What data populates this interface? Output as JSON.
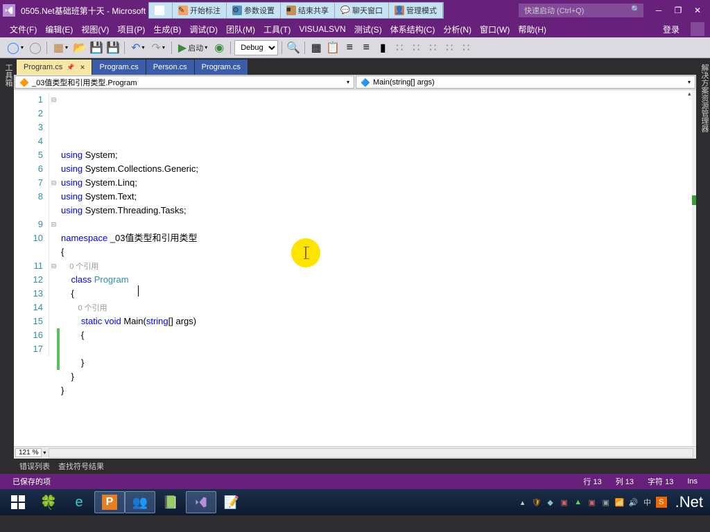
{
  "window": {
    "title": "0505.Net基础班第十天 - Microsoft",
    "quick_launch_placeholder": "快速启动 (Ctrl+Q)"
  },
  "share_toolbar": {
    "items": [
      {
        "label": "开始标注",
        "color": "#f4a460"
      },
      {
        "label": "参数设置",
        "color": "#5090c0"
      },
      {
        "label": "结束共享",
        "color": "#c09050"
      },
      {
        "label": "聊天窗口",
        "color": "#e0e0e0"
      },
      {
        "label": "管理模式",
        "color": "#d08050"
      }
    ]
  },
  "menu": {
    "items": [
      "文件(F)",
      "编辑(E)",
      "视图(V)",
      "项目(P)",
      "生成(B)",
      "调试(D)",
      "团队(M)",
      "工具(T)",
      "VISUALSVN",
      "测试(S)",
      "体系结构(C)",
      "分析(N)",
      "窗口(W)",
      "帮助(H)"
    ],
    "login": "登录"
  },
  "toolbar": {
    "start": "启动",
    "config": "Debug"
  },
  "side_panels": {
    "left": "工具箱",
    "right": "解决方案资源管理器"
  },
  "tabs": [
    {
      "label": "Program.cs",
      "active": true,
      "pinned": true
    },
    {
      "label": "Program.cs",
      "active": false
    },
    {
      "label": "Person.cs",
      "active": false
    },
    {
      "label": "Program.cs",
      "active": false
    }
  ],
  "nav": {
    "left": "_03值类型和引用类型.Program",
    "right": "Main(string[] args)"
  },
  "code": {
    "lines": [
      {
        "n": 1,
        "fold": "⊟",
        "tokens": [
          {
            "t": "using ",
            "c": "kw"
          },
          {
            "t": "System;",
            "c": "punct"
          }
        ]
      },
      {
        "n": 2,
        "fold": "",
        "tokens": [
          {
            "t": "using ",
            "c": "kw"
          },
          {
            "t": "System.Collections.Generic;",
            "c": "punct"
          }
        ]
      },
      {
        "n": 3,
        "fold": "",
        "tokens": [
          {
            "t": "using ",
            "c": "kw"
          },
          {
            "t": "System.Linq;",
            "c": "punct"
          }
        ]
      },
      {
        "n": 4,
        "fold": "",
        "tokens": [
          {
            "t": "using ",
            "c": "kw"
          },
          {
            "t": "System.Text;",
            "c": "punct"
          }
        ]
      },
      {
        "n": 5,
        "fold": "",
        "tokens": [
          {
            "t": "using ",
            "c": "kw"
          },
          {
            "t": "System.Threading.Tasks;",
            "c": "punct"
          }
        ]
      },
      {
        "n": 6,
        "fold": "",
        "tokens": []
      },
      {
        "n": 7,
        "fold": "⊟",
        "tokens": [
          {
            "t": "namespace ",
            "c": "kw"
          },
          {
            "t": "_03值类型和引用类型",
            "c": "punct"
          }
        ]
      },
      {
        "n": 8,
        "fold": "",
        "tokens": [
          {
            "t": "{",
            "c": "punct"
          }
        ]
      },
      {
        "n": "",
        "fold": "",
        "tokens": [
          {
            "t": "    0 个引用",
            "c": "ref"
          }
        ]
      },
      {
        "n": 9,
        "fold": "⊟",
        "tokens": [
          {
            "t": "    class ",
            "c": "kw"
          },
          {
            "t": "Program",
            "c": "type"
          }
        ]
      },
      {
        "n": 10,
        "fold": "",
        "tokens": [
          {
            "t": "    {",
            "c": "punct"
          }
        ]
      },
      {
        "n": "",
        "fold": "",
        "tokens": [
          {
            "t": "        0 个引用",
            "c": "ref"
          }
        ]
      },
      {
        "n": 11,
        "fold": "⊟",
        "tokens": [
          {
            "t": "        static void ",
            "c": "kw"
          },
          {
            "t": "Main(",
            "c": "punct"
          },
          {
            "t": "string",
            "c": "kw"
          },
          {
            "t": "[] args)",
            "c": "punct"
          }
        ]
      },
      {
        "n": 12,
        "fold": "",
        "tokens": [
          {
            "t": "        {",
            "c": "punct"
          }
        ],
        "changed": true
      },
      {
        "n": 13,
        "fold": "",
        "tokens": [
          {
            "t": "            ",
            "c": "punct"
          }
        ],
        "changed": true
      },
      {
        "n": 14,
        "fold": "",
        "tokens": [
          {
            "t": "        }",
            "c": "punct"
          }
        ],
        "changed": true
      },
      {
        "n": 15,
        "fold": "",
        "tokens": [
          {
            "t": "    }",
            "c": "punct"
          }
        ]
      },
      {
        "n": 16,
        "fold": "",
        "tokens": [
          {
            "t": "}",
            "c": "punct"
          }
        ]
      },
      {
        "n": 17,
        "fold": "",
        "tokens": []
      }
    ]
  },
  "zoom": "121 %",
  "output_tabs": [
    "错误列表",
    "查找符号结果"
  ],
  "status": {
    "left": "已保存的项",
    "line": "行 13",
    "col": "列 13",
    "char": "字符 13",
    "ins": "Ins"
  },
  "taskbar": {
    "dotnet": ".Net"
  }
}
